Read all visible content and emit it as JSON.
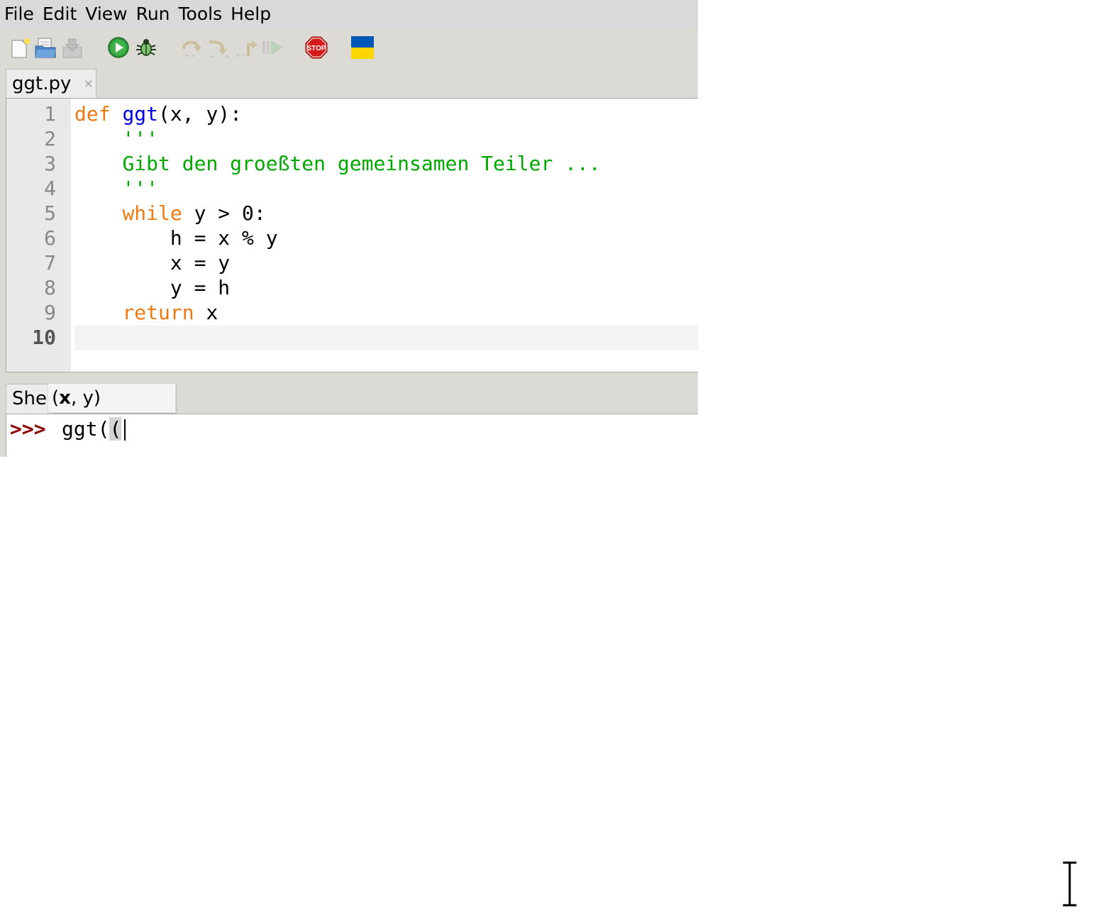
{
  "menu": {
    "items": [
      "File",
      "Edit",
      "View",
      "Run",
      "Tools",
      "Help"
    ]
  },
  "toolbar": {
    "buttons": [
      {
        "name": "new-file",
        "icon": "new-file-icon"
      },
      {
        "name": "open-file",
        "icon": "open-folder-icon"
      },
      {
        "name": "save-file",
        "icon": "save-icon"
      },
      {
        "name": "run",
        "icon": "run-icon"
      },
      {
        "name": "debug",
        "icon": "bug-icon"
      },
      {
        "name": "step-over",
        "icon": "step-over-icon"
      },
      {
        "name": "step-into",
        "icon": "step-into-icon"
      },
      {
        "name": "step-out",
        "icon": "step-out-icon"
      },
      {
        "name": "resume",
        "icon": "resume-icon"
      },
      {
        "name": "stop",
        "icon": "stop-icon",
        "label": "STOP"
      },
      {
        "name": "ukraine",
        "icon": "ukraine-flag-icon"
      }
    ],
    "colors": {
      "run": "#2e9a3a",
      "stop": "#d61a1a",
      "flag_blue": "#0057b7",
      "flag_yellow": "#ffd700"
    }
  },
  "editor": {
    "tab_label": "ggt.py",
    "tab_close": "×",
    "current_line": 10,
    "line_numbers": [
      "1",
      "2",
      "3",
      "4",
      "5",
      "6",
      "7",
      "8",
      "9",
      "10"
    ],
    "lines": {
      "l1": {
        "kw": "def",
        "fn": "ggt",
        "rest": "(x, y):"
      },
      "l2": {
        "str": "'''"
      },
      "l3": {
        "str": "Gibt den groeßten gemeinsamen Teiler ..."
      },
      "l4": {
        "str": "'''"
      },
      "l5": {
        "kw": "while",
        "rest": " y > 0:"
      },
      "l6": {
        "text": "h = x % y"
      },
      "l7": {
        "text": "x = y"
      },
      "l8": {
        "text": "y = h"
      },
      "l9": {
        "kw": "return",
        "rest": " x"
      }
    },
    "colors": {
      "keyword": "#ef7a12",
      "function": "#0000e6",
      "string": "#00a800"
    }
  },
  "shell": {
    "tab_label": "She",
    "prompt": ">>>",
    "input_before": "ggt(",
    "input_hl": "("
  },
  "calltip": {
    "open": "(",
    "bold_arg": "x",
    "rest": ", y)"
  }
}
